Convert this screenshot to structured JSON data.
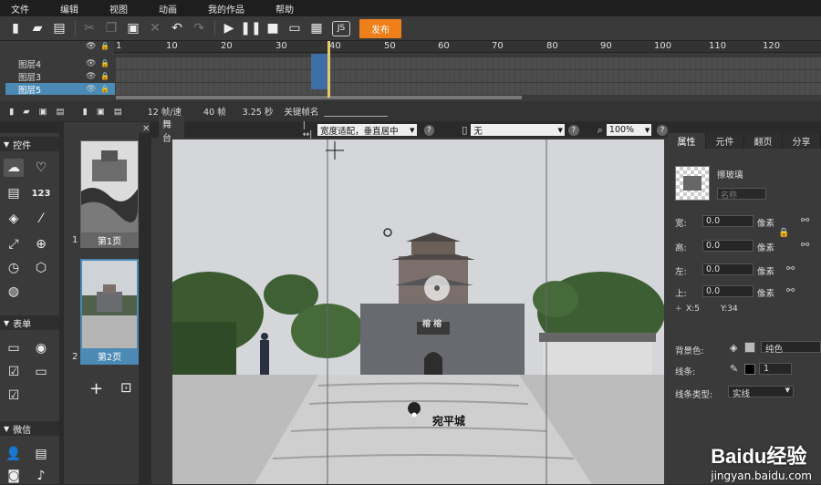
{
  "menu": [
    "文件",
    "编辑",
    "视图",
    "动画",
    "我的作品",
    "帮助"
  ],
  "toolbar": {
    "publish_label": "发布",
    "js_label": "JS"
  },
  "timeline": {
    "ruler_ticks": [
      "1",
      "10",
      "20",
      "30",
      "40",
      "50",
      "60",
      "70",
      "80",
      "90",
      "100",
      "110",
      "120"
    ],
    "layers": [
      {
        "name": "图层4",
        "selected": false
      },
      {
        "name": "图层3",
        "selected": false
      },
      {
        "name": "图层5",
        "selected": true
      }
    ],
    "playhead_frame": "40",
    "status": {
      "fps": "12 帧/速",
      "frames": "40 帧",
      "seconds": "3.25 秒",
      "keyframe_label": "关键帧名"
    }
  },
  "left_panel": {
    "section_controls": "控件",
    "section_forms": "表单",
    "section_wechat": "微信",
    "count_icon_label": "123"
  },
  "pages": [
    {
      "label": "第1页",
      "number": "1"
    },
    {
      "label": "第2页",
      "number": "2"
    }
  ],
  "stage": {
    "tab_label": "舞台",
    "fit_mode": "宽度适配，垂直居中",
    "device": "无",
    "zoom": "100%",
    "sign_text": "榕 榕",
    "location_label": "宛平城"
  },
  "right_panel": {
    "tabs": [
      "属性",
      "元件",
      "翻页",
      "分享"
    ],
    "element_name": "擦玻璃",
    "name_placeholder": "名称",
    "width_label": "宽:",
    "width_value": "0.0",
    "height_label": "高:",
    "height_value": "0.0",
    "left_label": "左:",
    "left_value": "0.0",
    "top_label": "上:",
    "top_value": "0.0",
    "unit": "像素",
    "x_readout": "X:5",
    "y_readout": "Y:34",
    "bg_label": "背景色:",
    "bg_fill": "纯色",
    "line_label": "线条:",
    "line_value": "1",
    "line_type_label": "线条类型:",
    "line_type": "实线"
  },
  "watermark": {
    "brand": "Baidu经验",
    "url": "jingyan.baidu.com"
  },
  "colors": {
    "accent": "#ef7f1a",
    "selection": "#4a8ab5",
    "playhead": "#e8c96a"
  }
}
